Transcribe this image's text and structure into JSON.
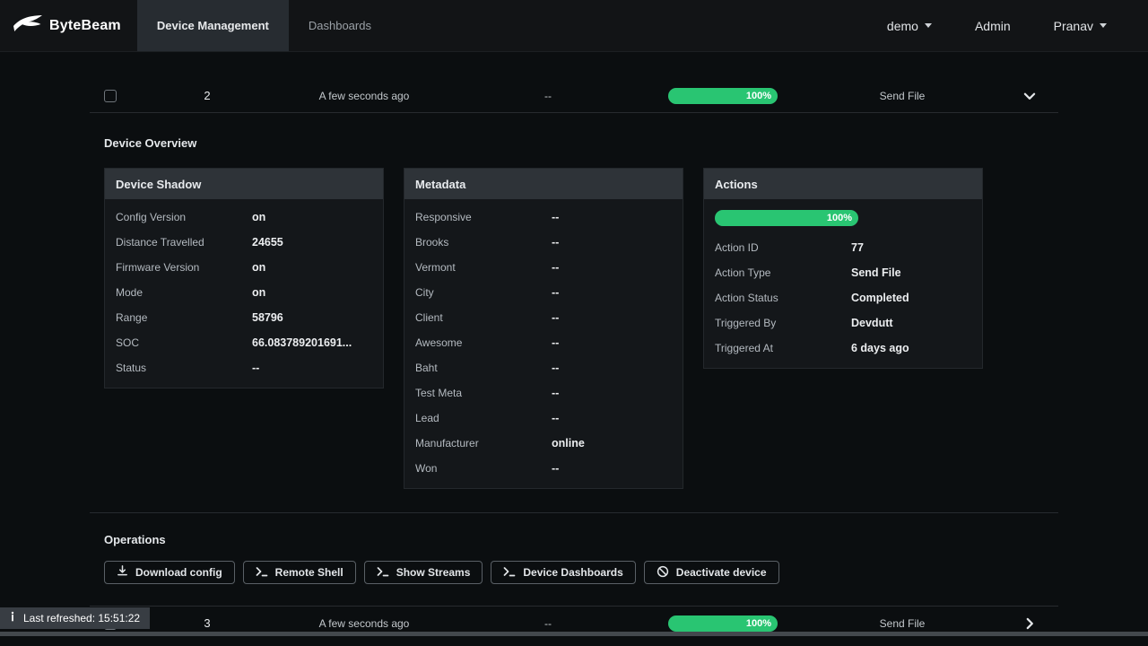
{
  "navbar": {
    "brand": "ByteBeam",
    "tabs": [
      {
        "label": "Device Management"
      },
      {
        "label": "Dashboards"
      }
    ],
    "project": "demo",
    "admin": "Admin",
    "user": "Pranav"
  },
  "rows": {
    "top": {
      "id": "2",
      "heartbeat": "A few seconds ago",
      "dash": "--",
      "progress": "100%",
      "action": "Send File"
    },
    "bottom": {
      "id": "3",
      "heartbeat": "A few seconds ago",
      "dash": "--",
      "progress": "100%",
      "action": "Send File"
    }
  },
  "overview": {
    "title": "Device Overview",
    "cards": [
      {
        "title": "Device Shadow",
        "rows": [
          {
            "label": "Config Version",
            "value": "on"
          },
          {
            "label": "Distance Travelled",
            "value": "24655"
          },
          {
            "label": "Firmware Version",
            "value": "on"
          },
          {
            "label": "Mode",
            "value": "on"
          },
          {
            "label": "Range",
            "value": "58796"
          },
          {
            "label": "SOC",
            "value": "66.083789201691..."
          },
          {
            "label": "Status",
            "value": "--"
          }
        ]
      },
      {
        "title": "Metadata",
        "rows": [
          {
            "label": "Responsive",
            "value": "--"
          },
          {
            "label": "Brooks",
            "value": "--"
          },
          {
            "label": "Vermont",
            "value": "--"
          },
          {
            "label": "City",
            "value": "--"
          },
          {
            "label": "Client",
            "value": "--"
          },
          {
            "label": "Awesome",
            "value": "--"
          },
          {
            "label": "Baht",
            "value": "--"
          },
          {
            "label": "Test Meta",
            "value": "--"
          },
          {
            "label": "Lead",
            "value": "--"
          },
          {
            "label": "Manufacturer",
            "value": "online"
          },
          {
            "label": "Won",
            "value": "--"
          }
        ]
      },
      {
        "title": "Actions",
        "progress": "100%",
        "rows": [
          {
            "label": "Action ID",
            "value": "77"
          },
          {
            "label": "Action Type",
            "value": "Send File"
          },
          {
            "label": "Action Status",
            "value": "Completed"
          },
          {
            "label": "Triggered By",
            "value": "Devdutt"
          },
          {
            "label": "Triggered At",
            "value": "6 days ago"
          }
        ]
      }
    ]
  },
  "operations": {
    "title": "Operations",
    "buttons": [
      {
        "label": "Download config",
        "icon": "download-icon"
      },
      {
        "label": "Remote Shell",
        "icon": "terminal-icon"
      },
      {
        "label": "Show Streams",
        "icon": "terminal-icon"
      },
      {
        "label": "Device Dashboards",
        "icon": "terminal-icon"
      },
      {
        "label": "Deactivate device",
        "icon": "prohibit-icon"
      }
    ]
  },
  "status_bar": {
    "text": "Last refreshed: 15:51:22"
  },
  "colors": {
    "accent_green": "#29c572",
    "navbar_bg": "#121416",
    "page_bg": "#0b0e10"
  }
}
